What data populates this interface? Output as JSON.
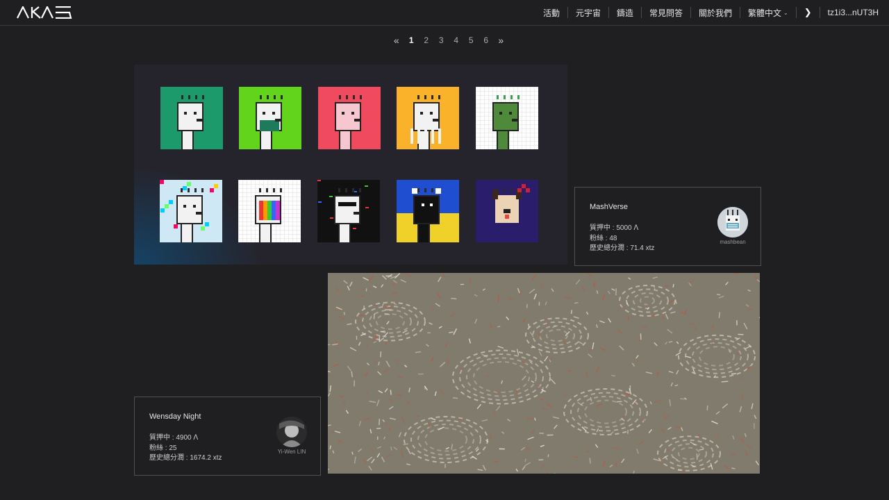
{
  "brand": {
    "logo_text": "AKAS"
  },
  "nav": {
    "items": [
      "活動",
      "元宇宙",
      "鑄造",
      "常見問答",
      "關於我們"
    ],
    "language": "繁體中文",
    "theme_toggle": "❯",
    "wallet": "tz1i3...nUT3H"
  },
  "pagination": {
    "prev": "«",
    "pages": [
      "1",
      "2",
      "3",
      "4",
      "5",
      "6"
    ],
    "active_page": "1",
    "next": "»"
  },
  "collections": [
    {
      "title": "MashVerse",
      "staking": "質押中 : 5000 ꓥ",
      "followers": "粉絲 : 48",
      "total_profit": "歷史總分潤 : 71.4 xtz",
      "creator": "mashbean",
      "tile_colors": [
        "#1d9a6c",
        "#63d41c",
        "#f04a5f",
        "#f9b22a",
        "#ffffff",
        "#cfe8f5",
        "#ffffff",
        "#111111",
        "#1f4fd0",
        "#2a1d6b"
      ]
    },
    {
      "title": "Wensday Night",
      "staking": "質押中 : 4900 ꓥ",
      "followers": "粉絲 : 25",
      "total_profit": "歷史總分潤 : 1674.2 xtz",
      "creator": "Yi-Wen LIN"
    }
  ]
}
